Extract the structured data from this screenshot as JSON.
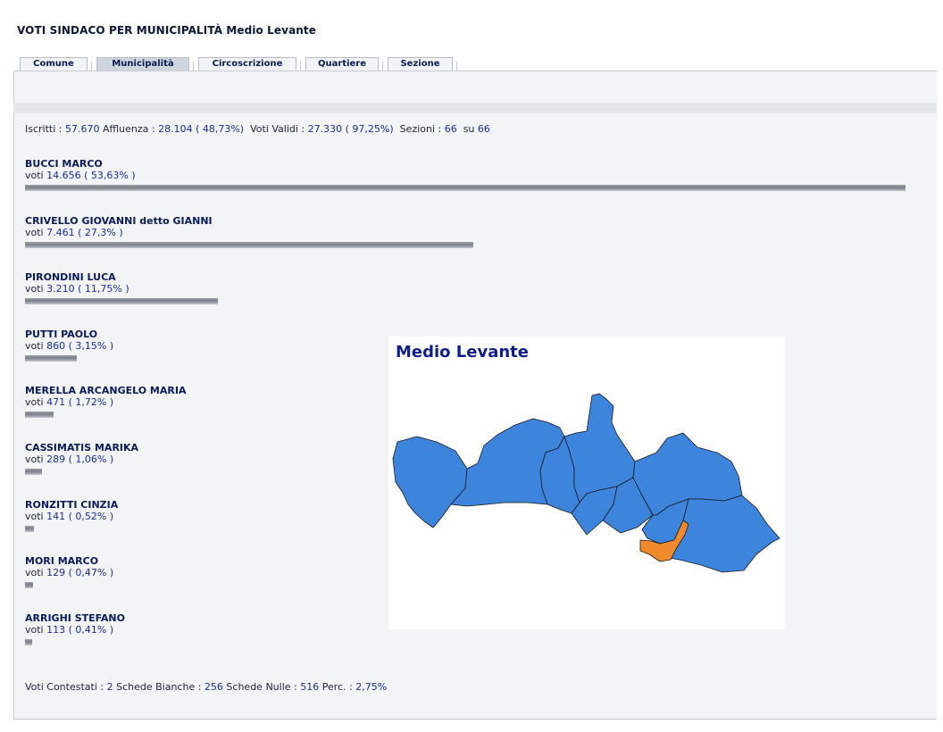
{
  "title": "VOTI SINDACO PER MUNICIPALITÀ Medio Levante",
  "tabs": [
    {
      "label": "Comune",
      "active": false
    },
    {
      "label": "Municipalità",
      "active": true
    },
    {
      "label": "Circoscrizione",
      "active": false
    },
    {
      "label": "Quartiere",
      "active": false
    },
    {
      "label": "Sezione",
      "active": false
    }
  ],
  "stats": {
    "iscritti_label": "Iscritti :",
    "iscritti": "57.670",
    "affluenza_label": "Affluenza :",
    "affluenza": "28.104 ( 48,73%)",
    "validi_label": "Voti Validi :",
    "validi": "27.330 ( 97,25%)",
    "sezioni_label": "Sezioni :",
    "sezioni": "66",
    "su_label": "su",
    "sezioni_tot": "66"
  },
  "candidates": [
    {
      "name": "BUCCI MARCO",
      "votes_label": "voti",
      "votes": "14.656 ( 53,63% )",
      "share_pct": 53.63
    },
    {
      "name": "CRIVELLO GIOVANNI detto GIANNI",
      "votes_label": "voti",
      "votes": "7.461 ( 27,3% )",
      "share_pct": 27.3
    },
    {
      "name": "PIRONDINI LUCA",
      "votes_label": "voti",
      "votes": "3.210 ( 11,75% )",
      "share_pct": 11.75
    },
    {
      "name": "PUTTI PAOLO",
      "votes_label": "voti",
      "votes": "860 ( 3,15% )",
      "share_pct": 3.15
    },
    {
      "name": "MERELLA ARCANGELO MARIA",
      "votes_label": "voti",
      "votes": "471 ( 1,72% )",
      "share_pct": 1.72
    },
    {
      "name": "CASSIMATIS MARIKA",
      "votes_label": "voti",
      "votes": "289 ( 1,06% )",
      "share_pct": 1.06
    },
    {
      "name": "RONZITTI CINZIA",
      "votes_label": "voti",
      "votes": "141 ( 0,52% )",
      "share_pct": 0.52
    },
    {
      "name": "MORI MARCO",
      "votes_label": "voti",
      "votes": "129 ( 0,47% )",
      "share_pct": 0.47
    },
    {
      "name": "ARRIGHI STEFANO",
      "votes_label": "voti",
      "votes": "113 ( 0,41% )",
      "share_pct": 0.41
    }
  ],
  "footer": {
    "contestati_label": "Voti Contestati :",
    "contestati": "2",
    "bianche_label": "Schede Bianche :",
    "bianche": "256",
    "nulle_label": "Schede Nulle :",
    "nulle": "516",
    "perc_label": "Perc. :",
    "perc": "2,75%"
  },
  "map": {
    "title": "Medio Levante",
    "base_color": "#3d84dc",
    "highlight_color": "#f08a2c",
    "border_color": "#1a1a1a"
  }
}
